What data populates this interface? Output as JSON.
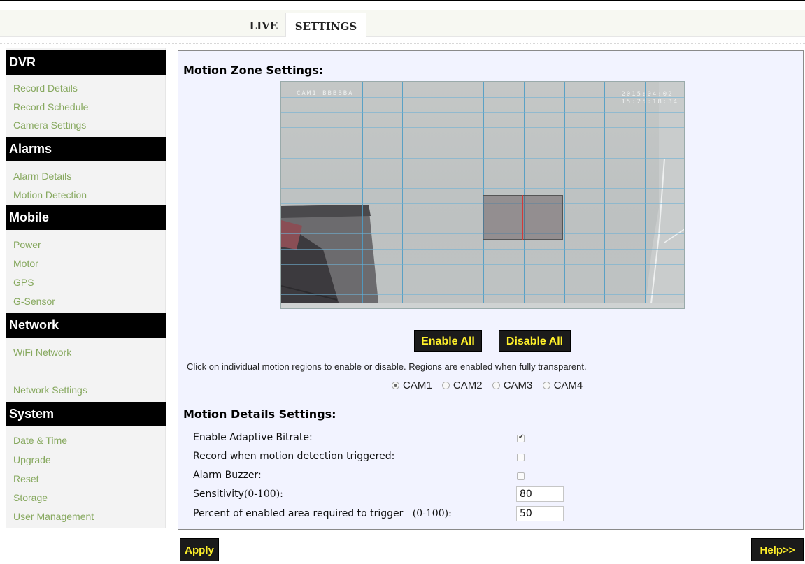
{
  "tabs": {
    "live": "LIVE",
    "settings": "SETTINGS"
  },
  "sidebar": {
    "sections": [
      {
        "title": "DVR",
        "items": [
          "Record Details",
          "Record Schedule",
          "Camera Settings"
        ]
      },
      {
        "title": "Alarms",
        "items": [
          "Alarm Details",
          "Motion Detection"
        ]
      },
      {
        "title": "Mobile",
        "items": [
          "Power",
          "Motor",
          "GPS",
          "G-Sensor"
        ]
      },
      {
        "title": "Network",
        "items": [
          "WiFi Network",
          "Network Settings"
        ]
      },
      {
        "title": "System",
        "items": [
          "Date & Time",
          "Upgrade",
          "Reset",
          "Storage",
          "User Management"
        ]
      }
    ]
  },
  "motion_zone": {
    "title": "Motion Zone Settings:",
    "camera_overlay": {
      "label": "CAM1  BBBBBA",
      "date": "2015:04:02",
      "time": "15:25:18:34"
    },
    "enable_all": "Enable All",
    "disable_all": "Disable All",
    "hint": "Click on individual motion regions to enable or disable. Regions are enabled when fully transparent.",
    "cameras": [
      "CAM1",
      "CAM2",
      "CAM3",
      "CAM4"
    ],
    "selected_camera": "CAM1"
  },
  "motion_details": {
    "title": "Motion Details Settings:",
    "adaptive_bitrate": {
      "label": "Enable Adaptive Bitrate:",
      "checked": true
    },
    "record_on_motion": {
      "label": "Record when motion detection triggered:",
      "checked": false
    },
    "alarm_buzzer": {
      "label": "Alarm Buzzer:",
      "checked": false
    },
    "sensitivity": {
      "label": "Sensitivity",
      "range": "(0-100):",
      "value": "80"
    },
    "percent_area": {
      "label": "Percent of enabled area required to trigger",
      "range": "(0-100):",
      "value": "50"
    }
  },
  "footer": {
    "apply": "Apply",
    "help": "Help>>"
  },
  "colors": {
    "accent_yellow": "#fff02a",
    "link_green": "#86a85e",
    "panel_bg": "#f2f3ff"
  }
}
